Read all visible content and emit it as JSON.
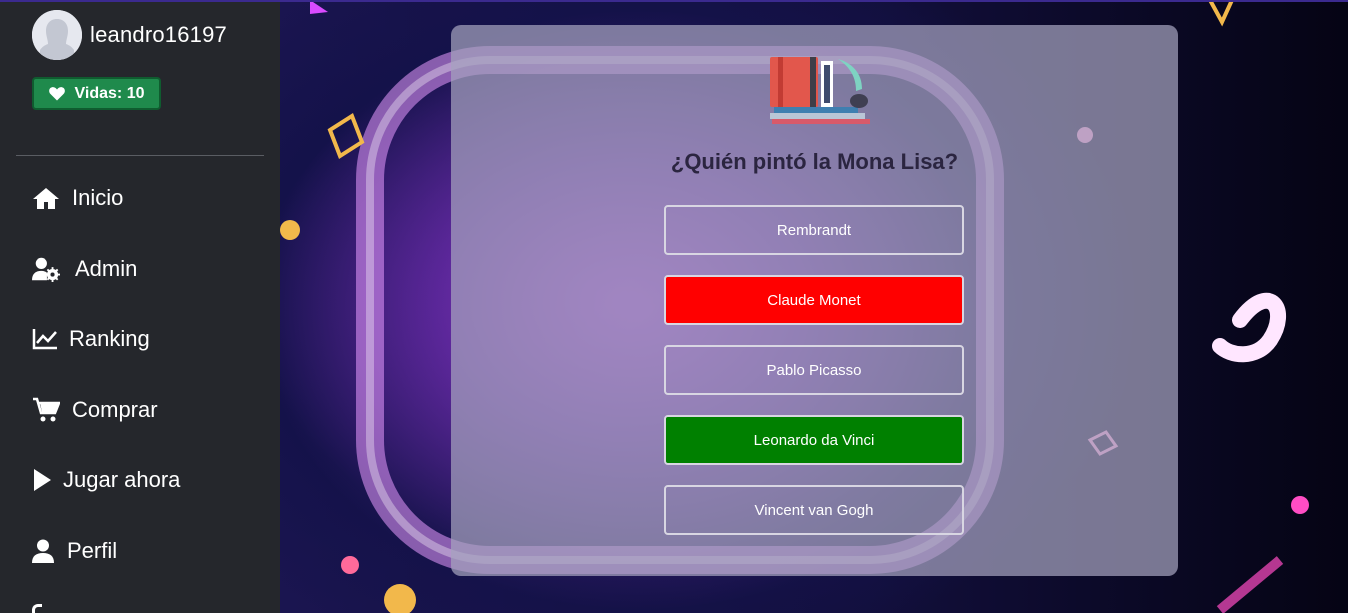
{
  "user": {
    "name": "leandro16197",
    "lives_label": "Vidas: 10"
  },
  "nav": {
    "items": [
      {
        "label": "Inicio",
        "icon": "home-icon"
      },
      {
        "label": "Admin",
        "icon": "user-gear-icon"
      },
      {
        "label": "Ranking",
        "icon": "chart-line-icon"
      },
      {
        "label": "Comprar",
        "icon": "cart-icon"
      },
      {
        "label": "Jugar ahora",
        "icon": "play-icon"
      },
      {
        "label": "Perfil",
        "icon": "user-icon"
      }
    ]
  },
  "quiz": {
    "category_icon": "books-icon",
    "question": "¿Quién pintó la Mona Lisa?",
    "answers": [
      {
        "label": "Rembrandt",
        "state": "neutral"
      },
      {
        "label": "Claude Monet",
        "state": "wrong"
      },
      {
        "label": "Pablo Picasso",
        "state": "neutral"
      },
      {
        "label": "Leonardo da Vinci",
        "state": "correct"
      },
      {
        "label": "Vincent van Gogh",
        "state": "neutral"
      }
    ]
  },
  "colors": {
    "sidebar_bg": "#25272c",
    "lives_badge": "#1f8a4c",
    "wrong": "#ff0000",
    "correct": "#008000"
  }
}
